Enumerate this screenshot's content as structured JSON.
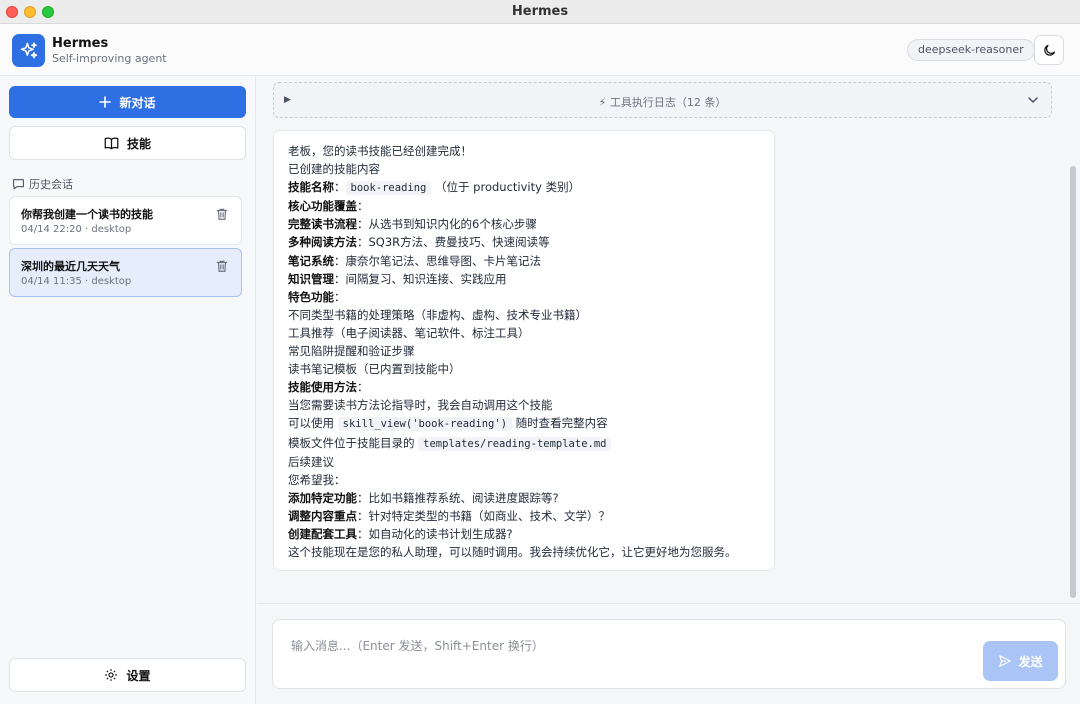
{
  "window": {
    "title": "Hermes"
  },
  "header": {
    "app_name": "Hermes",
    "app_subtitle": "Self-improving agent",
    "model": "deepseek-reasoner",
    "theme_icon": "moon-icon",
    "logo_icon": "sparkles-icon"
  },
  "sidebar": {
    "new_chat_label": "新对话",
    "skills_label": "技能",
    "history_label": "历史会话",
    "sessions": [
      {
        "title": "你帮我创建一个读书的技能",
        "meta": "04/14 22:20 · desktop",
        "active": false
      },
      {
        "title": "深圳的最近几天天气",
        "meta": "04/14 11:35 · desktop",
        "active": true
      }
    ],
    "settings_label": "设置"
  },
  "tool_log": {
    "label": "⚡ 工具执行日志（12 条）"
  },
  "message": {
    "l1": "老板，您的读书技能已经创建完成！",
    "l2": "已创建的技能内容",
    "l3_label": "技能名称",
    "l3_code": "book-reading",
    "l3_rest": "（位于 productivity 类别）",
    "l4": "核心功能覆盖",
    "l5_label": "完整读书流程",
    "l5_rest": "：从选书到知识内化的6个核心步骤",
    "l6_label": "多种阅读方法",
    "l6_rest": "：SQ3R方法、费曼技巧、快速阅读等",
    "l7_label": "笔记系统",
    "l7_rest": "：康奈尔笔记法、思维导图、卡片笔记法",
    "l8_label": "知识管理",
    "l8_rest": "：间隔复习、知识连接、实践应用",
    "l9": "特色功能",
    "l10": "不同类型书籍的处理策略（非虚构、虚构、技术专业书籍）",
    "l11": "工具推荐（电子阅读器、笔记软件、标注工具）",
    "l12": "常见陷阱提醒和验证步骤",
    "l13": "读书笔记模板（已内置到技能中）",
    "l14": "技能使用方法",
    "l15": "当您需要读书方法论指导时，我会自动调用这个技能",
    "l16_pre": "可以使用",
    "l16_code": "skill_view('book-reading')",
    "l16_rest": "随时查看完整内容",
    "l17_pre": "模板文件位于技能目录的",
    "l17_code": "templates/reading-template.md",
    "l18": "后续建议",
    "l19": "您希望我：",
    "l20_label": "添加特定功能",
    "l20_rest": "：比如书籍推荐系统、阅读进度跟踪等?",
    "l21_label": "调整内容重点",
    "l21_rest": "：针对特定类型的书籍（如商业、技术、文学）？",
    "l22_label": "创建配套工具",
    "l22_rest": "：如自动化的读书计划生成器?",
    "l23": "这个技能现在是您的私人助理，可以随时调用。我会持续优化它，让它更好地为您服务。"
  },
  "composer": {
    "placeholder": "输入消息...（Enter 发送，Shift+Enter 换行）",
    "send_label": "发送"
  }
}
